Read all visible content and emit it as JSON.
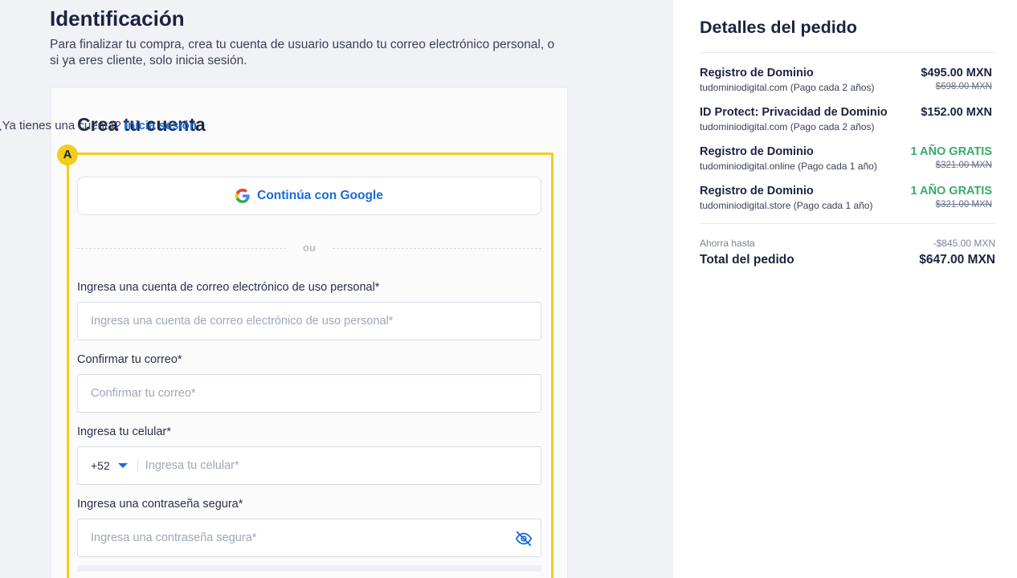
{
  "identification": {
    "title": "Identificación",
    "description": "Para finalizar tu compra, crea tu cuenta de usuario usando tu correo electrónico personal, o si ya eres cliente, solo inicia sesión."
  },
  "account_form": {
    "title": "Crea tu cuenta",
    "login_prompt": "¿Ya tienes una cuenta?",
    "login_link": "Inicia sesión",
    "badge": "A",
    "google_button": "Continúa con Google",
    "divider_text": "ou",
    "email": {
      "label": "Ingresa una cuenta de correo electrónico de uso personal*",
      "placeholder": "Ingresa una cuenta de correo electrónico de uso personal*"
    },
    "confirm_email": {
      "label": "Confirmar tu correo*",
      "placeholder": "Confirmar tu correo*"
    },
    "phone": {
      "label": "Ingresa tu celular*",
      "country_code": "+52",
      "placeholder": "Ingresa tu celular*"
    },
    "password": {
      "label": "Ingresa una contraseña segura*",
      "placeholder": "Ingresa una contraseña segura*"
    }
  },
  "order": {
    "title": "Detalles del pedido",
    "items": [
      {
        "name": "Registro de Dominio",
        "desc": "tudominiodigital.com (Pago cada 2 años)",
        "price": "$495.00 MXN",
        "old_price": "$698.00 MXN",
        "free": false
      },
      {
        "name": "ID Protect: Privacidad de Dominio",
        "desc": "tudominiodigital.com (Pago cada 2 años)",
        "price": "$152.00 MXN",
        "old_price": "",
        "free": false
      },
      {
        "name": "Registro de Dominio",
        "desc": "tudominiodigital.online (Pago cada 1 año)",
        "price": "1 AÑO GRATIS",
        "old_price": "$321.00 MXN",
        "free": true
      },
      {
        "name": "Registro de Dominio",
        "desc": "tudominiodigital.store (Pago cada 1 año)",
        "price": "1 AÑO GRATIS",
        "old_price": "$321.00 MXN",
        "free": true
      }
    ],
    "savings_label": "Ahorra hasta",
    "savings_value": "-$845.00 MXN",
    "total_label": "Total del pedido",
    "total_value": "$647.00 MXN"
  },
  "colors": {
    "accent": "#1b6bd6",
    "highlight": "#f2cd1c",
    "free": "#3aaa6b"
  }
}
